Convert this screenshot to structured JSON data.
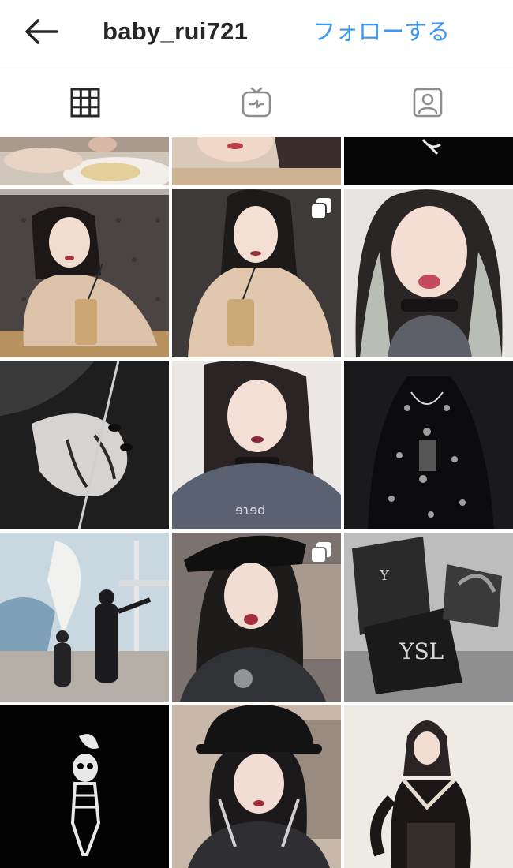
{
  "header": {
    "username": "baby_rui721",
    "follow_label": "フォローする",
    "accent_color": "#3897f0"
  },
  "tabs": [
    {
      "name": "grid",
      "icon": "grid-icon",
      "selected": true
    },
    {
      "name": "igtv",
      "icon": "igtv-icon",
      "selected": false
    },
    {
      "name": "tagged",
      "icon": "tagged-person-icon",
      "selected": false
    }
  ],
  "posts": [
    {
      "subject": "meal-closeup",
      "multiple": false
    },
    {
      "subject": "portrait-crop",
      "multiple": false
    },
    {
      "subject": "black-artwork",
      "multiple": false
    },
    {
      "subject": "cafe-selfie-with-drink",
      "multiple": false
    },
    {
      "subject": "cafe-selfie-with-drink-closeup",
      "multiple": true
    },
    {
      "subject": "selfie-tongue-out",
      "multiple": false
    },
    {
      "subject": "hands-black-nails",
      "multiple": false
    },
    {
      "subject": "selfie-choker-sweatshirt",
      "multiple": false
    },
    {
      "subject": "black-lace-dress",
      "multiple": false
    },
    {
      "subject": "outdoor-family-photo",
      "multiple": false
    },
    {
      "subject": "bucket-hat-selfie",
      "multiple": true
    },
    {
      "subject": "ysl-gift-bags",
      "multiple": false
    },
    {
      "subject": "skeleton-rose-art",
      "multiple": false
    },
    {
      "subject": "bucket-hat-fork-knife",
      "multiple": false
    },
    {
      "subject": "black-dress-portrait",
      "multiple": false
    }
  ]
}
